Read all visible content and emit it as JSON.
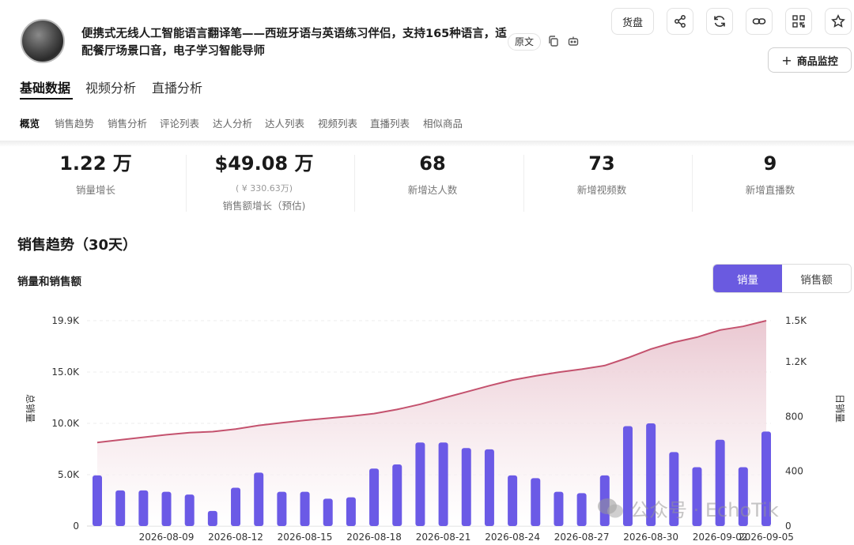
{
  "product": {
    "title": "便携式无线人工智能语言翻译笔——西班牙语与英语练习伴侣，支持165种语言，适配餐厅场景口音，电子学习智能导师",
    "original_label": "原文"
  },
  "toolbar": {
    "huopan_label": "货盘",
    "monitor_label": "商品监控"
  },
  "main_tabs": [
    {
      "label": "基础数据"
    },
    {
      "label": "视频分析"
    },
    {
      "label": "直播分析"
    }
  ],
  "sub_tabs": [
    {
      "label": "概览"
    },
    {
      "label": "销售趋势"
    },
    {
      "label": "销售分析"
    },
    {
      "label": "评论列表"
    },
    {
      "label": "达人分析"
    },
    {
      "label": "达人列表"
    },
    {
      "label": "视频列表"
    },
    {
      "label": "直播列表"
    },
    {
      "label": "相似商品"
    }
  ],
  "stats": [
    {
      "value": "1.22 万",
      "sub": "",
      "label": "销量增长"
    },
    {
      "value": "$49.08 万",
      "sub": "( ¥ 330.63万)",
      "label": "销售额增长（预估)"
    },
    {
      "value": "68",
      "sub": "",
      "label": "新增达人数"
    },
    {
      "value": "73",
      "sub": "",
      "label": "新增视频数"
    },
    {
      "value": "9",
      "sub": "",
      "label": "新增直播数"
    }
  ],
  "section": {
    "title": "销售趋势（30天）",
    "chart_title": "销量和销售额"
  },
  "toggle": {
    "options": [
      "销量",
      "销售额"
    ],
    "selected": "销量"
  },
  "watermark": {
    "text": "公众号 · EchoTik"
  },
  "colors": {
    "accent": "#6a5ae0",
    "bar": "#6b5ae6",
    "line": "#c4526e",
    "area_top": "#e9c5cf"
  },
  "chart_data": {
    "type": "bar+line",
    "xlabel": "",
    "ylabel_left": "总销量",
    "ylabel_right": "日销量",
    "yticks_left": [
      "0",
      "5.0K",
      "10.0K",
      "15.0K",
      "19.9K"
    ],
    "yticks_right": [
      "0",
      "400",
      "800",
      "1.2K",
      "1.5K"
    ],
    "ylim_left": [
      0,
      19900
    ],
    "ylim_right": [
      0,
      1500
    ],
    "xtick_labels": [
      "2026-08-09",
      "2026-08-12",
      "2026-08-15",
      "2026-08-18",
      "2026-08-21",
      "2026-08-24",
      "2026-08-27",
      "2026-08-30",
      "2026-09-02",
      "2026-09-05"
    ],
    "dates": [
      "2026-08-06",
      "2026-08-07",
      "2026-08-08",
      "2026-08-09",
      "2026-08-10",
      "2026-08-11",
      "2026-08-12",
      "2026-08-13",
      "2026-08-14",
      "2026-08-15",
      "2026-08-16",
      "2026-08-17",
      "2026-08-18",
      "2026-08-19",
      "2026-08-20",
      "2026-08-21",
      "2026-08-22",
      "2026-08-23",
      "2026-08-24",
      "2026-08-25",
      "2026-08-26",
      "2026-08-27",
      "2026-08-28",
      "2026-08-29",
      "2026-08-30",
      "2026-08-31",
      "2026-09-01",
      "2026-09-02",
      "2026-09-03",
      "2026-09-04",
      "2026-09-05"
    ],
    "series": [
      {
        "name": "日销量",
        "type": "bar",
        "axis": "right",
        "values": [
          370,
          260,
          260,
          250,
          230,
          110,
          280,
          390,
          250,
          250,
          200,
          210,
          420,
          450,
          610,
          610,
          570,
          560,
          370,
          350,
          250,
          240,
          370,
          730,
          750,
          540,
          430,
          630,
          430,
          690
        ]
      },
      {
        "name": "总销量",
        "type": "line",
        "axis": "left",
        "values": [
          8100,
          8350,
          8600,
          8850,
          9050,
          9150,
          9400,
          9750,
          10000,
          10250,
          10450,
          10650,
          10900,
          11300,
          11800,
          12400,
          13000,
          13600,
          14150,
          14550,
          14900,
          15200,
          15550,
          16300,
          17150,
          17800,
          18300,
          19000,
          19350,
          19900
        ]
      }
    ]
  }
}
